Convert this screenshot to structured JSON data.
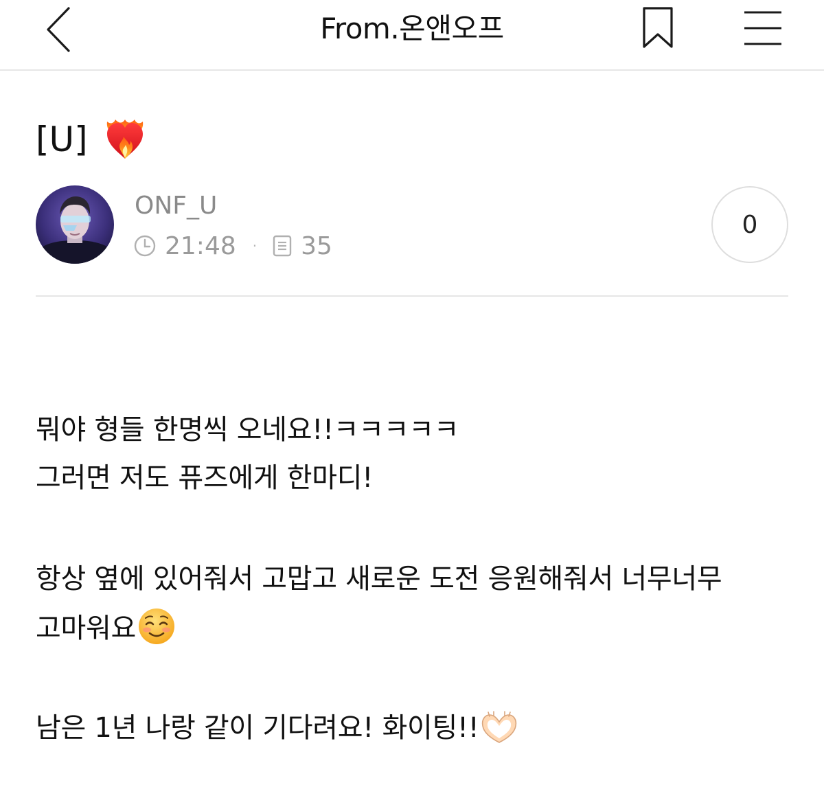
{
  "header": {
    "title": "From.온앤오프"
  },
  "post": {
    "title": "[U]",
    "author": "ONF_U",
    "time": "21:48",
    "count": "35",
    "like_count": "0"
  },
  "body": {
    "line1": "뭐야 형들 한명씩 오네요!!ㅋㅋㅋㅋㅋ",
    "line2": "그러면 저도 퓨즈에게 한마디!",
    "line3": "항상 옆에 있어줘서 고맙고 새로운 도전 응원해줘서 너무너무",
    "line4": "고마워요",
    "line5": "남은 1년 나랑 같이 기다려요! 화이팅!!"
  },
  "icons": {
    "back": "chevron-left-icon",
    "bookmark": "bookmark-icon",
    "menu": "hamburger-menu-icon",
    "title_emoji": "heart-on-fire-icon",
    "clock": "clock-icon",
    "views": "document-icon",
    "smile": "smiling-face-icon",
    "hands": "heart-hands-icon"
  }
}
